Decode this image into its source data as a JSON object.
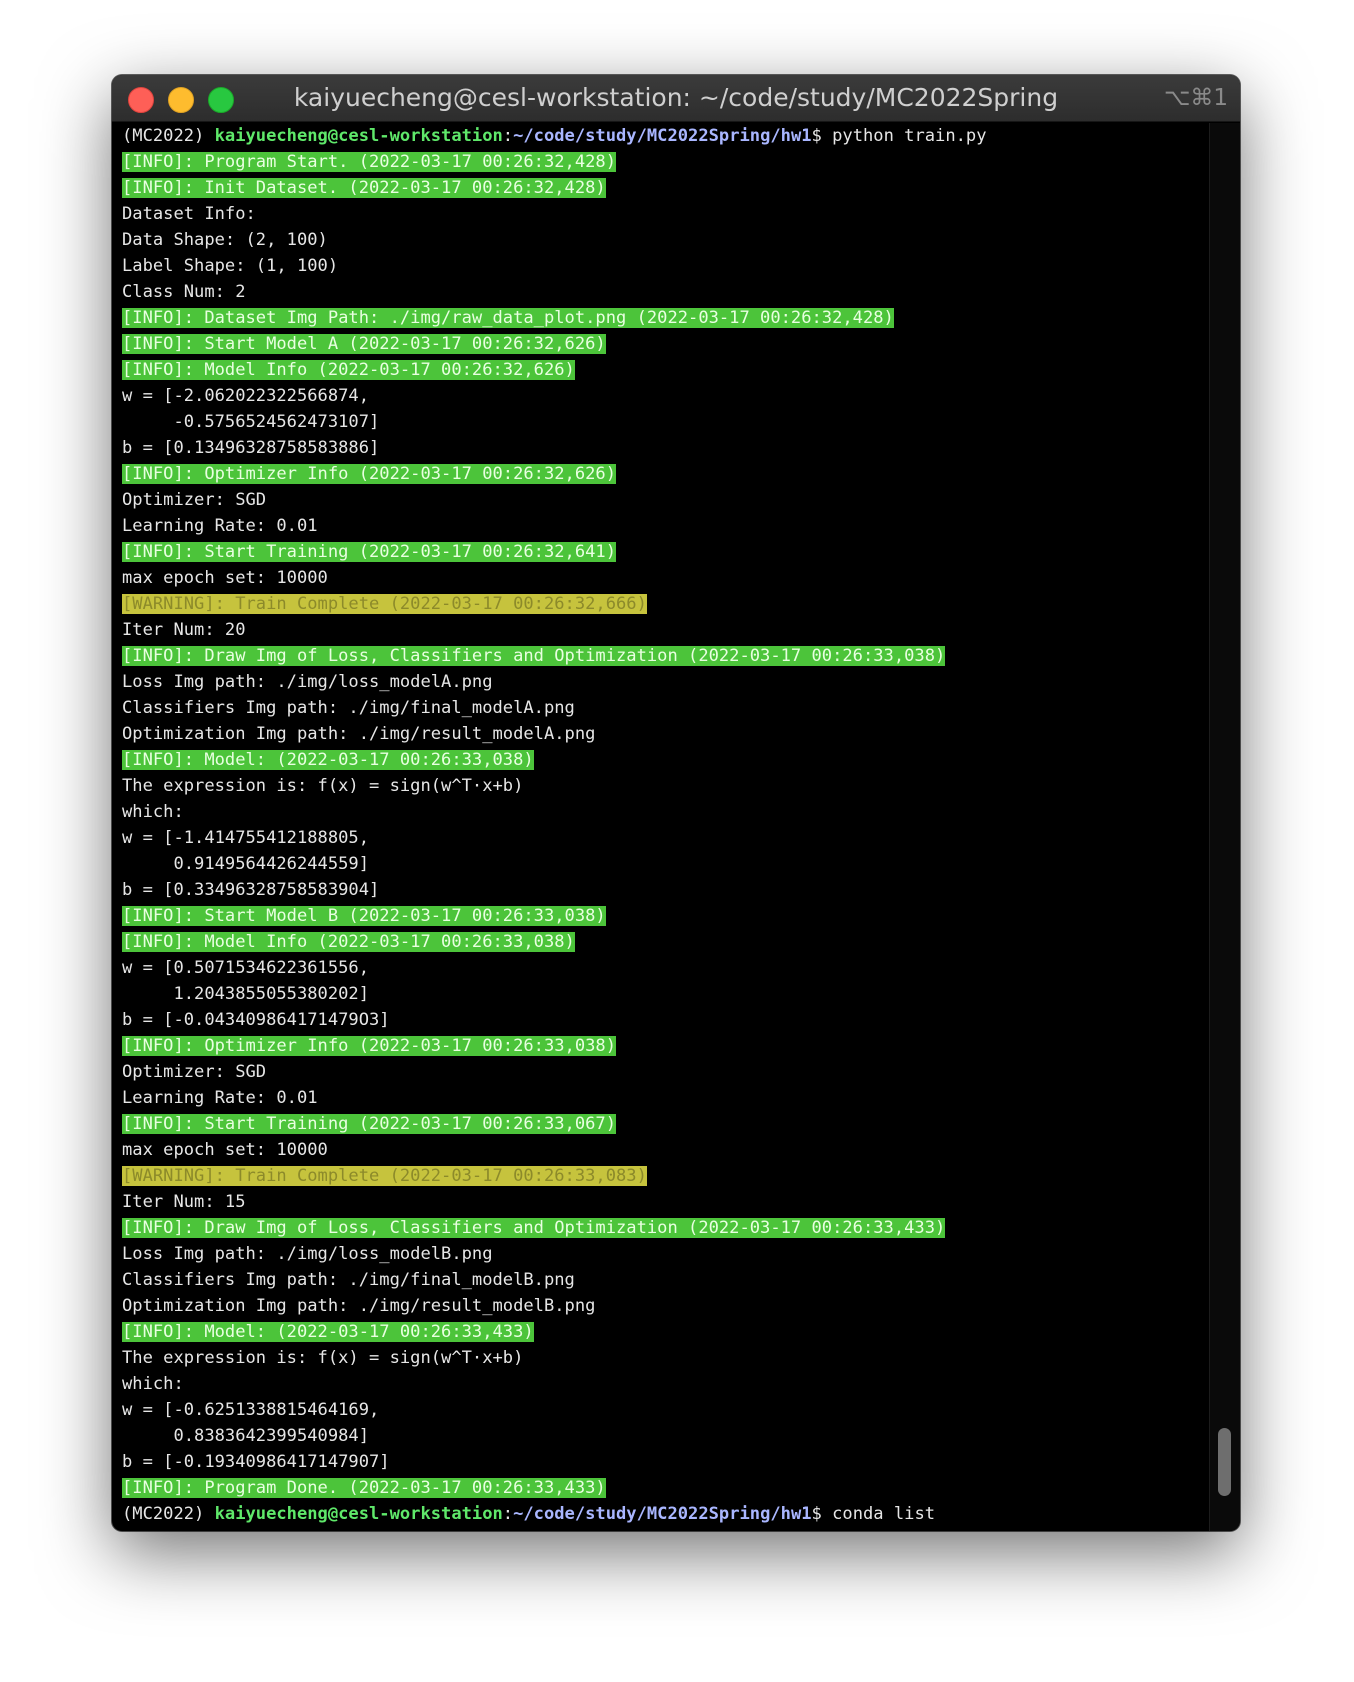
{
  "window": {
    "title": "kaiyuecheng@cesl-workstation: ~/code/study/MC2022Spring",
    "shortcut": "⌥⌘1"
  },
  "prompt": {
    "env": "(MC2022) ",
    "user": "kaiyuecheng@cesl-workstation",
    "path": "~/code/study/MC2022Spring/hw1",
    "symbol": "$ "
  },
  "lines": [
    {
      "type": "prompt",
      "text": "python train.py"
    },
    {
      "type": "info",
      "text": "[INFO]: Program Start. (2022-03-17 00:26:32,428)"
    },
    {
      "type": "info",
      "text": "[INFO]: Init Dataset. (2022-03-17 00:26:32,428)"
    },
    {
      "type": "plain",
      "text": "Dataset Info:"
    },
    {
      "type": "plain",
      "text": "Data Shape: (2, 100)"
    },
    {
      "type": "plain",
      "text": "Label Shape: (1, 100)"
    },
    {
      "type": "plain",
      "text": "Class Num: 2"
    },
    {
      "type": "info",
      "text": "[INFO]: Dataset Img Path: ./img/raw_data_plot.png (2022-03-17 00:26:32,428)"
    },
    {
      "type": "info",
      "text": "[INFO]: Start Model A (2022-03-17 00:26:32,626)"
    },
    {
      "type": "info",
      "text": "[INFO]: Model Info (2022-03-17 00:26:32,626)"
    },
    {
      "type": "plain",
      "text": "w = [-2.062022322566874,"
    },
    {
      "type": "plain",
      "text": "     -0.5756524562473107]"
    },
    {
      "type": "plain",
      "text": "b = [0.13496328758583886]"
    },
    {
      "type": "info",
      "text": "[INFO]: Optimizer Info (2022-03-17 00:26:32,626)"
    },
    {
      "type": "plain",
      "text": "Optimizer: SGD"
    },
    {
      "type": "plain",
      "text": "Learning Rate: 0.01"
    },
    {
      "type": "info",
      "text": "[INFO]: Start Training (2022-03-17 00:26:32,641)"
    },
    {
      "type": "plain",
      "text": "max epoch set: 10000"
    },
    {
      "type": "warn",
      "text": "[WARNING]: Train Complete (2022-03-17 00:26:32,666)"
    },
    {
      "type": "plain",
      "text": "Iter Num: 20"
    },
    {
      "type": "info",
      "text": "[INFO]: Draw Img of Loss, Classifiers and Optimization (2022-03-17 00:26:33,038)"
    },
    {
      "type": "plain",
      "text": "Loss Img path: ./img/loss_modelA.png"
    },
    {
      "type": "plain",
      "text": "Classifiers Img path: ./img/final_modelA.png"
    },
    {
      "type": "plain",
      "text": "Optimization Img path: ./img/result_modelA.png"
    },
    {
      "type": "info",
      "text": "[INFO]: Model: (2022-03-17 00:26:33,038)"
    },
    {
      "type": "plain",
      "text": "The expression is: f(x) = sign(w^T·x+b)"
    },
    {
      "type": "plain",
      "text": "which:"
    },
    {
      "type": "plain",
      "text": "w = [-1.414755412188805,"
    },
    {
      "type": "plain",
      "text": "     0.9149564426244559]"
    },
    {
      "type": "plain",
      "text": "b = [0.33496328758583904]"
    },
    {
      "type": "info",
      "text": "[INFO]: Start Model B (2022-03-17 00:26:33,038)"
    },
    {
      "type": "info",
      "text": "[INFO]: Model Info (2022-03-17 00:26:33,038)"
    },
    {
      "type": "plain",
      "text": "w = [0.5071534622361556,"
    },
    {
      "type": "plain",
      "text": "     1.2043855055380202]"
    },
    {
      "type": "plain",
      "text": "b = [-0.043409864171479O3]"
    },
    {
      "type": "info",
      "text": "[INFO]: Optimizer Info (2022-03-17 00:26:33,038)"
    },
    {
      "type": "plain",
      "text": "Optimizer: SGD"
    },
    {
      "type": "plain",
      "text": "Learning Rate: 0.01"
    },
    {
      "type": "info",
      "text": "[INFO]: Start Training (2022-03-17 00:26:33,067)"
    },
    {
      "type": "plain",
      "text": "max epoch set: 10000"
    },
    {
      "type": "warn",
      "text": "[WARNING]: Train Complete (2022-03-17 00:26:33,083)"
    },
    {
      "type": "plain",
      "text": "Iter Num: 15"
    },
    {
      "type": "info",
      "text": "[INFO]: Draw Img of Loss, Classifiers and Optimization (2022-03-17 00:26:33,433)"
    },
    {
      "type": "plain",
      "text": "Loss Img path: ./img/loss_modelB.png"
    },
    {
      "type": "plain",
      "text": "Classifiers Img path: ./img/final_modelB.png"
    },
    {
      "type": "plain",
      "text": "Optimization Img path: ./img/result_modelB.png"
    },
    {
      "type": "info",
      "text": "[INFO]: Model: (2022-03-17 00:26:33,433)"
    },
    {
      "type": "plain",
      "text": "The expression is: f(x) = sign(w^T·x+b)"
    },
    {
      "type": "plain",
      "text": "which:"
    },
    {
      "type": "plain",
      "text": "w = [-0.6251338815464169,"
    },
    {
      "type": "plain",
      "text": "     0.8383642399540984]"
    },
    {
      "type": "plain",
      "text": "b = [-0.19340986417147907]"
    },
    {
      "type": "info",
      "text": "[INFO]: Program Done. (2022-03-17 00:26:33,433)"
    },
    {
      "type": "prompt",
      "text": "conda list"
    }
  ],
  "colors": {
    "info_bg": "#4cc43a",
    "warn_bg": "#c6c33d",
    "terminal_bg": "#000000",
    "user": "#5fe86a",
    "path": "#a9b6ff"
  },
  "scroll": {
    "position_fraction": 0.95
  }
}
